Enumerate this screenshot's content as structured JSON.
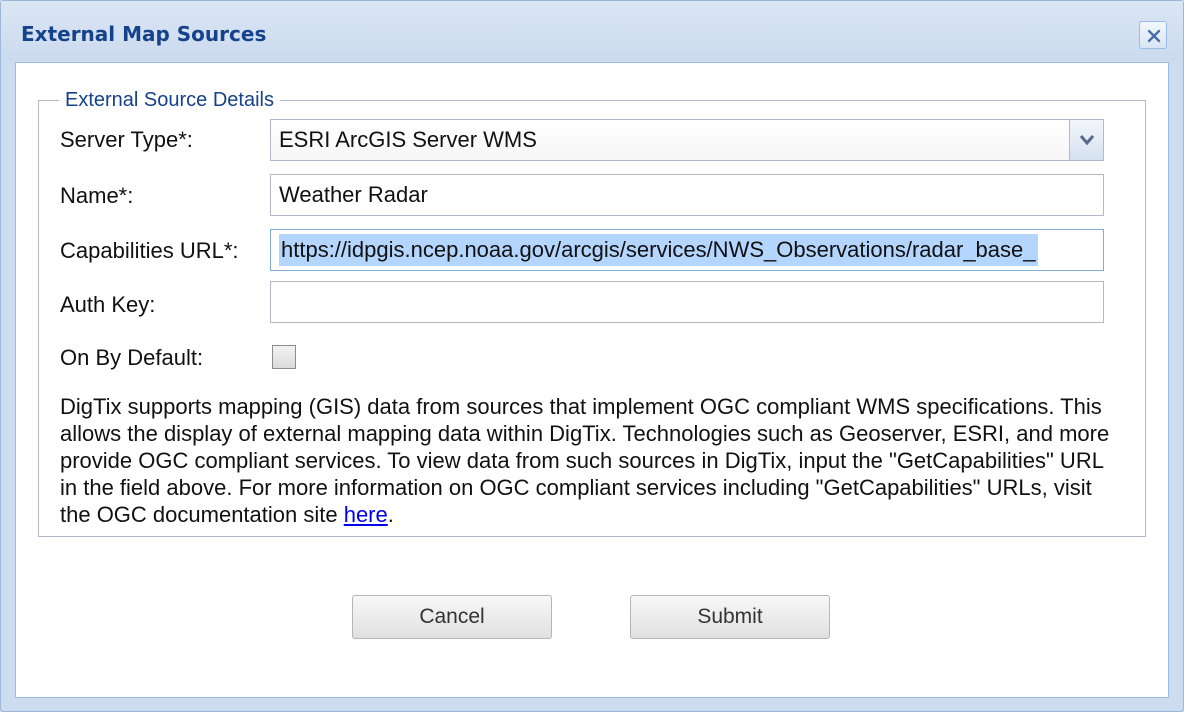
{
  "window": {
    "title": "External Map Sources",
    "close_icon": "close-icon"
  },
  "fieldset": {
    "legend": "External Source Details"
  },
  "form": {
    "server_type_label": "Server Type*:",
    "server_type_value": "ESRI ArcGIS Server WMS",
    "name_label": "Name*:",
    "name_value": "Weather Radar",
    "capabilities_label": "Capabilities URL*:",
    "capabilities_value": "https://idpgis.ncep.noaa.gov/arcgis/services/NWS_Observations/radar_base_",
    "auth_key_label": "Auth Key:",
    "auth_key_value": "",
    "on_by_default_label": "On By Default:",
    "on_by_default_checked": false
  },
  "description": {
    "text": "DigTix supports mapping (GIS) data from sources that implement OGC compliant WMS specifications. This allows the display of external mapping data within DigTix. Technologies such as Geoserver, ESRI, and more provide OGC compliant services. To view data from such sources in DigTix, input the \"GetCapabilities\" URL in the field above. For more information on OGC compliant services including \"GetCapabilities\" URLs, visit the OGC documentation site ",
    "link_text": "here",
    "trailing": "."
  },
  "buttons": {
    "cancel": "Cancel",
    "submit": "Submit"
  },
  "colors": {
    "title": "#15428b",
    "url_selection": "#b4d5fe",
    "link": "#0000ee"
  }
}
